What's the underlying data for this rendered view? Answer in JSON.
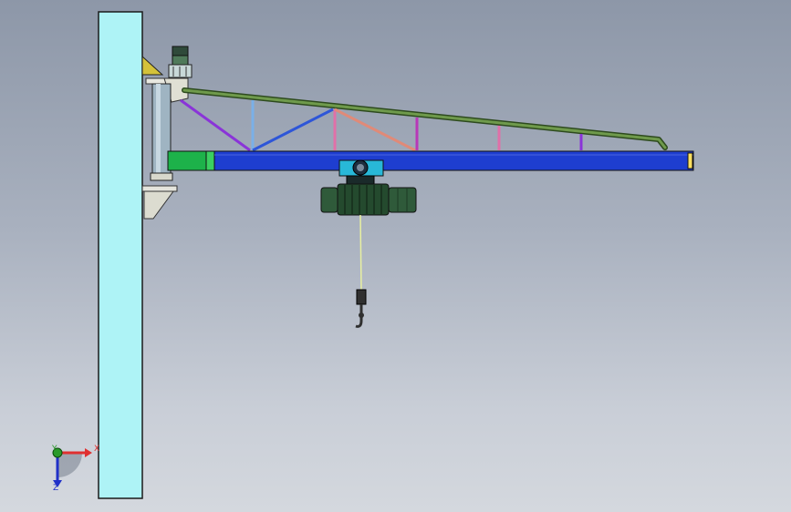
{
  "viewport": {
    "background_top": "#8d97a8",
    "background_bottom": "#d4d8de"
  },
  "model": {
    "colors": {
      "wall_column": "#aef3f6",
      "main_beam": "#1e3ed0",
      "beam_end_section": "#1db24a",
      "tie_rod": "#5a8a3c",
      "pivot_post": "#9fb4c2",
      "bracket": "#d8d8c8",
      "gusset_plate": "#d4c23a",
      "truss_purple": "#8a34d8",
      "truss_blue": "#2e56d8",
      "truss_lightblue": "#7ab0e8",
      "truss_pink": "#e070a8",
      "truss_salmon": "#e08a78",
      "truss_magenta": "#b838b8",
      "hoist_motor": "#2f5a3a",
      "hoist_trolley": "#28b8d8",
      "rope": "#e8f0a0",
      "hook": "#303030"
    }
  },
  "triad": {
    "x_label": "X",
    "y_label": "Y",
    "z_label": "Z",
    "x_color": "#e03030",
    "y_color": "#2a9a2a",
    "z_color": "#2030c8"
  }
}
